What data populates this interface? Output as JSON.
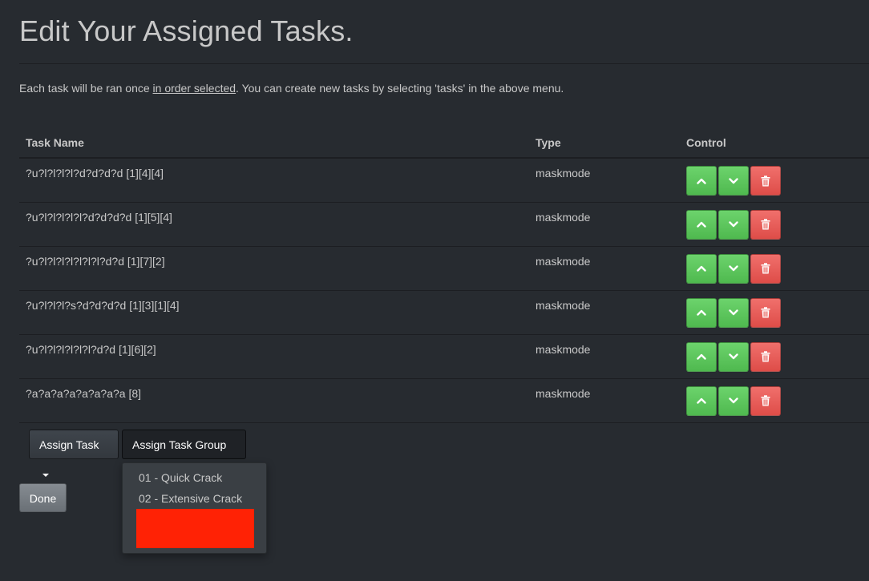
{
  "page": {
    "title": "Edit Your Assigned Tasks.",
    "intro_before": "Each task will be ran once ",
    "intro_link": "in order selected",
    "intro_after": ". You can create new tasks by selecting 'tasks' in the above menu."
  },
  "table": {
    "headers": [
      "Task Name",
      "Type",
      "Control"
    ],
    "rows": [
      {
        "name": "?u?l?l?l?l?d?d?d?d [1][4][4]",
        "type": "maskmode"
      },
      {
        "name": "?u?l?l?l?l?l?d?d?d?d [1][5][4]",
        "type": "maskmode"
      },
      {
        "name": "?u?l?l?l?l?l?l?l?d?d [1][7][2]",
        "type": "maskmode"
      },
      {
        "name": "?u?l?l?l?s?d?d?d?d [1][3][1][4]",
        "type": "maskmode"
      },
      {
        "name": "?u?l?l?l?l?l?l?d?d [1][6][2]",
        "type": "maskmode"
      },
      {
        "name": "?a?a?a?a?a?a?a?a [8]",
        "type": "maskmode"
      }
    ],
    "controls": {
      "up_icon": "chevron-up-icon",
      "down_icon": "chevron-down-icon",
      "delete_icon": "trash-icon"
    }
  },
  "actions": {
    "assign_task_label": "Assign Task",
    "assign_task_group_label": "Assign Task Group",
    "done_label": "Done"
  },
  "task_group_menu": {
    "items": [
      "01 - Quick Crack",
      "02 - Extensive Crack"
    ]
  },
  "colors": {
    "background": "#272b30",
    "success": "#5cc55c",
    "danger": "#e5534e",
    "redaction": "#ff2205"
  }
}
